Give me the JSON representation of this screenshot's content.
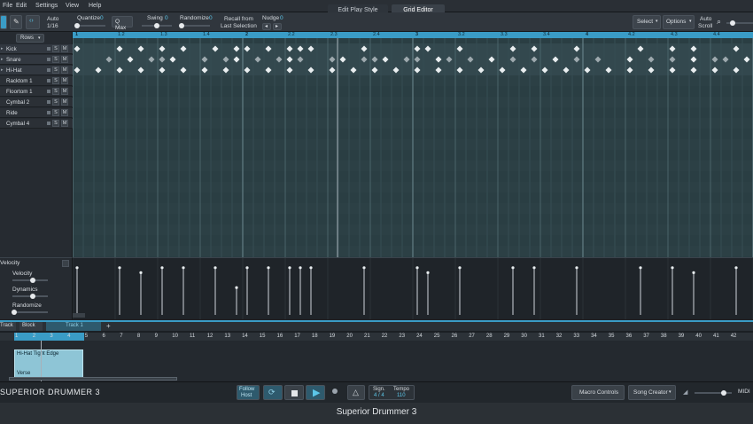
{
  "menu": [
    "File",
    "Edit",
    "Settings",
    "View",
    "Help"
  ],
  "view_tabs": [
    "Edit Play Style",
    "Grid Editor"
  ],
  "toolbar": {
    "auto_label": "Auto",
    "auto_value": "1/16",
    "quantize_label": "Quantize",
    "quantize_value": "0",
    "qmax_label": "Q Max",
    "swing_label": "Swing",
    "swing_value": "0",
    "randomize_label": "Randomize",
    "randomize_value": "0",
    "recall_label_1": "Recall from",
    "recall_label_2": "Last Selection",
    "nudge_label": "Nudge",
    "nudge_value": "0",
    "select_label": "Select",
    "options_label": "Options",
    "autoscroll_1": "Auto",
    "autoscroll_2": "Scroll"
  },
  "rows_button": "Rows",
  "tracks": [
    {
      "name": "Kick"
    },
    {
      "name": "Snare"
    },
    {
      "name": "Hi-Hat"
    },
    {
      "name": "Racktom 1"
    },
    {
      "name": "Floortom 1"
    },
    {
      "name": "Cymbal 2"
    },
    {
      "name": "Ride"
    },
    {
      "name": "Cymbal 4"
    }
  ],
  "solo_label": "S",
  "mute_label": "M",
  "ruler": [
    "1",
    "1.2",
    "1.3",
    "1.4",
    "2",
    "2.2",
    "2.3",
    "2.4",
    "3",
    "3.2",
    "3.3",
    "3.4",
    "4",
    "4.2",
    "4.3",
    "4.4"
  ],
  "velocity_panel": {
    "title": "Velocity",
    "velocity_label": "Velocity",
    "dynamics_label": "Dynamics",
    "randomize_label": "Randomize"
  },
  "song": {
    "tabs": [
      "Track",
      "Block",
      "Track 1"
    ],
    "bars": [
      "1",
      "2",
      "3",
      "4",
      "5",
      "6",
      "7",
      "8",
      "9",
      "10",
      "11",
      "12",
      "13",
      "14",
      "15",
      "16",
      "17",
      "18",
      "19",
      "20",
      "21",
      "22",
      "23",
      "24",
      "25",
      "26",
      "27",
      "28",
      "29",
      "30",
      "31",
      "32",
      "33",
      "34",
      "35",
      "36",
      "37",
      "38",
      "39",
      "40",
      "41",
      "42"
    ],
    "clip_name": "Hi-Hat Tight Edge",
    "clip_part": "Verse"
  },
  "transport": {
    "logo": "SUPERIOR DRUMMER 3",
    "follow_1": "Follow",
    "follow_2": "Host",
    "sign_label": "Sign.",
    "sign_value": "4 / 4",
    "tempo_label": "Tempo",
    "tempo_value": "110",
    "macro_label": "Macro Controls",
    "songcreator_label": "Song Creator",
    "midi_label": "MIDI"
  },
  "app_title": "Superior Drummer 3",
  "colors": {
    "accent": "#3a9cc6",
    "grid": "#2a3e43",
    "clip": "#8ec5d6"
  },
  "hits": {
    "kick": [
      0,
      4,
      6,
      8,
      10,
      13,
      15,
      16,
      18,
      20,
      21,
      22,
      27,
      32,
      33,
      36,
      41,
      43,
      47,
      53,
      56,
      58,
      62
    ],
    "snare": [
      3,
      5,
      7,
      8,
      9,
      12,
      14,
      15,
      17,
      19,
      20,
      21,
      24,
      25,
      27,
      28,
      29,
      31,
      32,
      34,
      35,
      37,
      39,
      41,
      43,
      45,
      47,
      49,
      52,
      54,
      56,
      58,
      60,
      61,
      63
    ],
    "hihat": [
      0,
      2,
      4,
      6,
      8,
      10,
      12,
      14,
      16,
      18,
      20,
      22,
      24,
      26,
      28,
      30,
      32,
      34,
      36,
      38,
      40,
      42,
      44,
      46,
      48,
      50,
      52,
      54,
      56,
      58,
      60,
      62
    ]
  },
  "velocity_values": [
    0.95,
    0.95,
    0.85,
    0.95,
    0.95,
    0.95,
    0.55,
    0.95,
    0.95,
    0.95,
    0.95,
    0.95,
    0.95,
    0.95,
    0.85,
    0.95,
    0.95,
    0.95,
    0.95,
    0.95,
    0.95,
    0.85,
    0.95
  ]
}
